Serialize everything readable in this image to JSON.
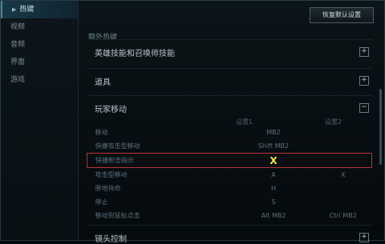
{
  "sidebar": {
    "items": [
      {
        "label": "热键",
        "active": true
      },
      {
        "label": "视频",
        "active": false
      },
      {
        "label": "音频",
        "active": false
      },
      {
        "label": "界面",
        "active": false
      },
      {
        "label": "游戏",
        "active": false
      }
    ]
  },
  "header": {
    "restore_label": "恢复默认设置"
  },
  "section": {
    "title": "额外热键"
  },
  "groups": [
    {
      "title": "英雄技能和召唤师技能",
      "toggle": "+"
    },
    {
      "title": "道具",
      "toggle": "+"
    },
    {
      "title": "玩家移动",
      "toggle": "−"
    },
    {
      "title": "镜头控制",
      "toggle": "+"
    }
  ],
  "columns": {
    "c1": "设置1",
    "c2": "设置2"
  },
  "rows": [
    {
      "action": "移动",
      "k1": "MB2",
      "k2": ""
    },
    {
      "action": "快捷攻击型移动",
      "k1": "Shift MB2",
      "k2": ""
    },
    {
      "action": "快捷射击指示",
      "k1": "X",
      "k2": "",
      "highlight": true
    },
    {
      "action": "攻击型移动",
      "k1": "A",
      "k2": "X"
    },
    {
      "action": "原地待命",
      "k1": "H",
      "k2": ""
    },
    {
      "action": "停止",
      "k1": "S",
      "k2": ""
    },
    {
      "action": "移动到鼠标点击",
      "k1": "Alt MB2",
      "k2": "Ctrl MB2"
    }
  ]
}
